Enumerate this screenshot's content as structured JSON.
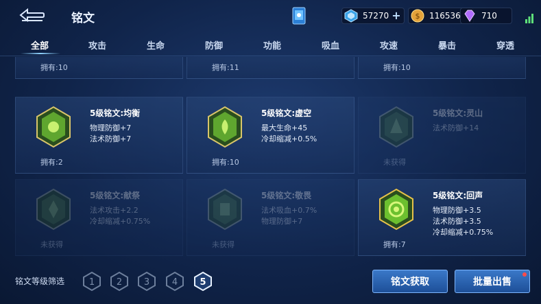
{
  "header": {
    "title": "铭文",
    "resources": {
      "diamond": "57270",
      "gold": "116536",
      "gem": "710"
    }
  },
  "tabs": [
    {
      "label": "全部",
      "active": true
    },
    {
      "label": "攻击"
    },
    {
      "label": "生命"
    },
    {
      "label": "防御"
    },
    {
      "label": "功能"
    },
    {
      "label": "吸血"
    },
    {
      "label": "攻速"
    },
    {
      "label": "暴击"
    },
    {
      "label": "穿透"
    }
  ],
  "top_row": [
    {
      "owned": "拥有:10"
    },
    {
      "owned": "拥有:11"
    },
    {
      "owned": "拥有:10"
    }
  ],
  "cards": [
    {
      "name": "5级铭文:均衡",
      "stats": [
        "物理防御+7",
        "法术防御+7"
      ],
      "owned": "拥有:2",
      "faded": false,
      "color": "#8fd64a"
    },
    {
      "name": "5级铭文:虚空",
      "stats": [
        "最大生命+45",
        "冷却缩减+0.5%"
      ],
      "owned": "拥有:10",
      "faded": false,
      "color": "#8fd64a"
    },
    {
      "name": "5级铭文:灵山",
      "stats": [
        "法术防御+14"
      ],
      "owned": "未获得",
      "faded": true,
      "color": "#6aa15a"
    },
    {
      "name": "5级铭文:献祭",
      "stats": [
        "法术攻击+2.2",
        "冷却缩减+0.75%"
      ],
      "owned": "未获得",
      "faded": true,
      "color": "#6aa15a"
    },
    {
      "name": "5级铭文:敬畏",
      "stats": [
        "法术吸血+0.7%",
        "物理防御+7"
      ],
      "owned": "未获得",
      "faded": true,
      "color": "#6aa15a"
    },
    {
      "name": "5级铭文:回声",
      "stats": [
        "物理防御+3.5",
        "法术防御+3.5",
        "冷却缩减+0.75%"
      ],
      "owned": "拥有:7",
      "faded": false,
      "color": "#8fd64a"
    }
  ],
  "bottom": {
    "filter_label": "铭文等级筛选",
    "levels": [
      "1",
      "2",
      "3",
      "4",
      "5"
    ],
    "selected_level": "5",
    "obtain_button": "铭文获取",
    "sell_button": "批量出售"
  }
}
